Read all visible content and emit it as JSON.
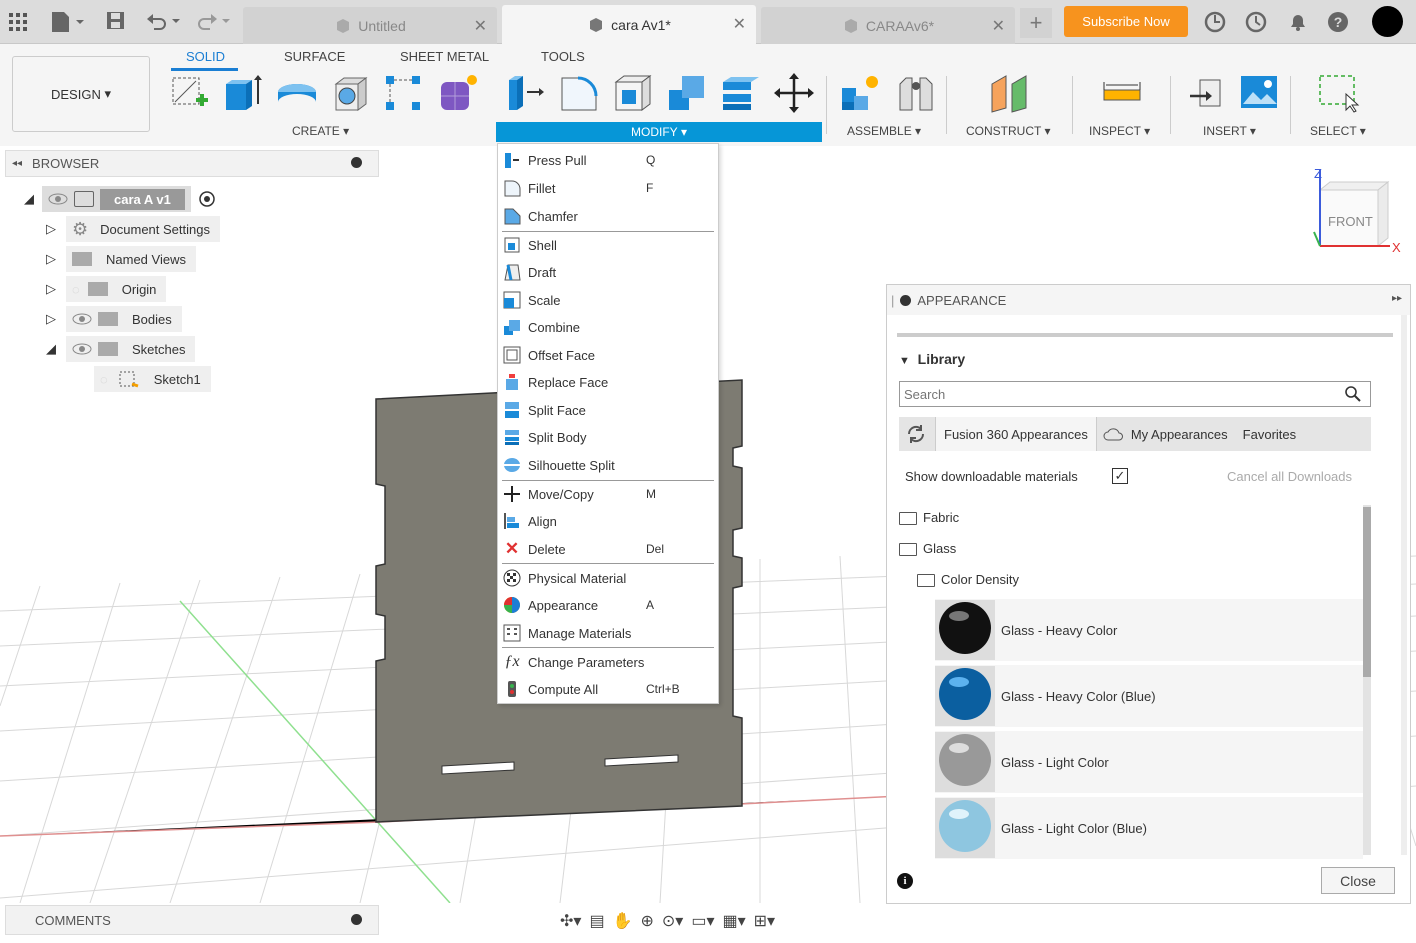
{
  "colors": {
    "accent": "#1a7ed3",
    "subscribe": "#f7931e",
    "modify_bar": "#0696d7"
  },
  "tabs": [
    {
      "label": "Untitled"
    },
    {
      "label": "cara Av1*"
    },
    {
      "label": "CARAAv6*"
    }
  ],
  "subscribe_label": "Subscribe Now",
  "toolbar": {
    "workspace": "DESIGN",
    "tabs": [
      "SOLID",
      "SURFACE",
      "SHEET METAL",
      "TOOLS"
    ],
    "groups": {
      "create": "CREATE",
      "modify": "MODIFY",
      "assemble": "ASSEMBLE",
      "construct": "CONSTRUCT",
      "inspect": "INSPECT",
      "insert": "INSERT",
      "select": "SELECT"
    }
  },
  "browser": {
    "title": "BROWSER",
    "root": "cara A v1",
    "items": [
      "Document Settings",
      "Named Views",
      "Origin",
      "Bodies",
      "Sketches",
      "Sketch1"
    ]
  },
  "modify_menu": [
    {
      "label": "Press Pull",
      "shortcut": "Q"
    },
    {
      "label": "Fillet",
      "shortcut": "F"
    },
    {
      "label": "Chamfer",
      "shortcut": ""
    },
    {
      "label": "Shell",
      "shortcut": ""
    },
    {
      "label": "Draft",
      "shortcut": ""
    },
    {
      "label": "Scale",
      "shortcut": ""
    },
    {
      "label": "Combine",
      "shortcut": ""
    },
    {
      "label": "Offset Face",
      "shortcut": ""
    },
    {
      "label": "Replace Face",
      "shortcut": ""
    },
    {
      "label": "Split Face",
      "shortcut": ""
    },
    {
      "label": "Split Body",
      "shortcut": ""
    },
    {
      "label": "Silhouette Split",
      "shortcut": ""
    },
    {
      "label": "Move/Copy",
      "shortcut": "M"
    },
    {
      "label": "Align",
      "shortcut": ""
    },
    {
      "label": "Delete",
      "shortcut": "Del"
    },
    {
      "label": "Physical Material",
      "shortcut": ""
    },
    {
      "label": "Appearance",
      "shortcut": "A"
    },
    {
      "label": "Manage Materials",
      "shortcut": ""
    },
    {
      "label": "Change Parameters",
      "shortcut": ""
    },
    {
      "label": "Compute All",
      "shortcut": "Ctrl+B"
    }
  ],
  "viewcube": {
    "face": "FRONT",
    "z": "Z",
    "x": "X"
  },
  "appearance": {
    "title": "APPEARANCE",
    "library": "Library",
    "search_placeholder": "Search",
    "tabs": [
      "Fusion 360 Appearances",
      "My Appearances",
      "Favorites"
    ],
    "show_downloadable": "Show downloadable materials",
    "cancel_downloads": "Cancel all Downloads",
    "folders": [
      "Fabric",
      "Glass",
      "Color Density"
    ],
    "items": [
      "Glass - Heavy Color",
      "Glass - Heavy Color (Blue)",
      "Glass - Light Color",
      "Glass - Light Color (Blue)"
    ],
    "close": "Close"
  },
  "comments": "COMMENTS"
}
